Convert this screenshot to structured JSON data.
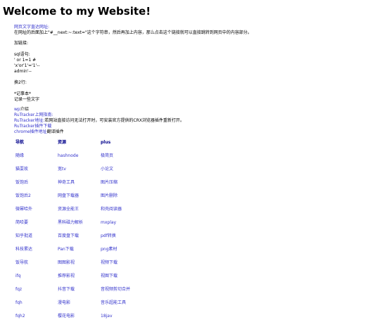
{
  "page": {
    "title": "Welcome to my Website!",
    "intro": {
      "link_label": "网页文字直达网址:",
      "text": "在网址的后面加上\"#__next:~:text=\"这个字符串，然后再加上内容，那么点击这个链接就可以直接跳转到网页中的内容部分。"
    },
    "add_link": "加链接:",
    "sql": {
      "label": "sql语句:",
      "lines": [
        "' or 1=1  #",
        "'x'or'1'='1'--",
        "admin'--"
      ]
    },
    "newline": "换2行:",
    "notepad": {
      "label": "*记事本*",
      "text": "记录一些文字"
    },
    "wp": {
      "link": "wp",
      "text": "介绍"
    },
    "rutracker": {
      "guide": "RuTracker上网指南:",
      "addr_link": "RuTracker地址:",
      "addr_text": "若网站直接访问无法打开时，可安装官方提供的CRX浏览器插件重新打开。",
      "plugin": "RuTracker插件下载",
      "chrome_link": "chrome插件地址",
      "chrome_text": "翻译插件"
    }
  },
  "nav_table": {
    "headers": [
      "导航",
      "资源",
      "plus"
    ],
    "rows": [
      [
        "随缘",
        "hashnode",
        "极简页"
      ],
      [
        "猫耍玫",
        "宽tv",
        "小论文"
      ],
      [
        "饭饱后",
        "神奇工具",
        "图片压缩"
      ],
      [
        "饭饱后2",
        "网盘下载器",
        "图片删除"
      ],
      [
        "微幂哈外",
        "资源全能王",
        "和壳阅读器"
      ],
      [
        "简哈要",
        "黑科磁力解析",
        "mxplay"
      ],
      [
        "知乎批道",
        "百度盘下载",
        "pdf转换"
      ],
      [
        "科技累达",
        "Pan下载",
        "png素材"
      ],
      [
        "饭导航",
        "图图影视",
        "视频下载"
      ],
      [
        "ifq",
        "推荐影视",
        "视图下载"
      ],
      [
        "fqz",
        "抖音下载",
        "音视频剪切合并"
      ],
      [
        "fqh",
        "漫电影",
        "音乐超能工具"
      ],
      [
        "fqh2",
        "樱花电影",
        "18jav"
      ]
    ]
  }
}
